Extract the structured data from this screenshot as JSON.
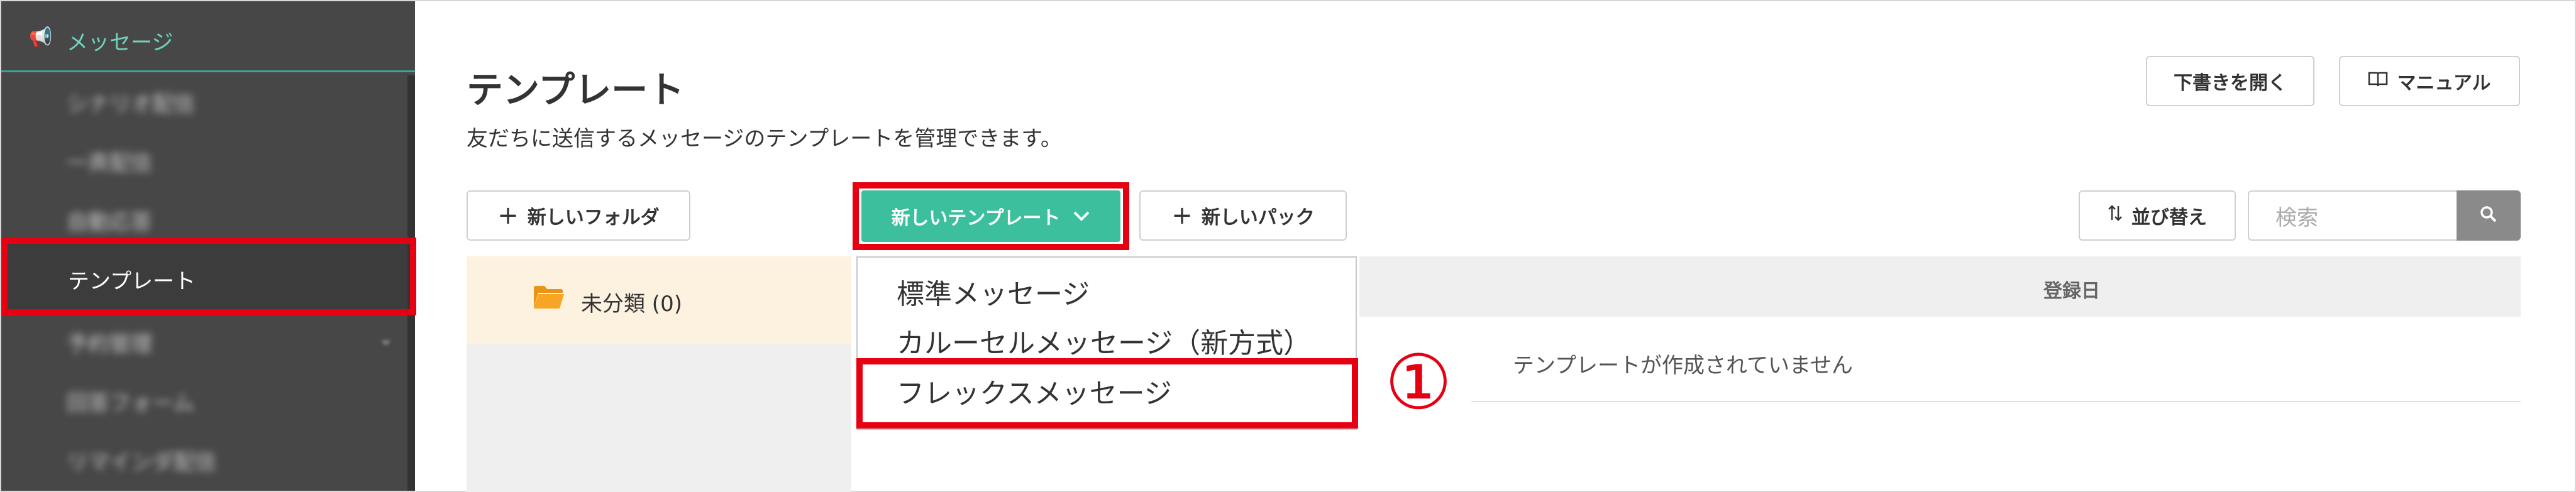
{
  "sidebar": {
    "section_label": "メッセージ",
    "section_icon": "megaphone-icon",
    "items": [
      {
        "label": "シナリオ配信"
      },
      {
        "label": "一斉配信"
      },
      {
        "label": "自動応答"
      },
      {
        "label": "テンプレート"
      },
      {
        "label": "予約管理"
      },
      {
        "label": "回答フォーム"
      },
      {
        "label": "リマインダ配信"
      }
    ],
    "active_item": "テンプレート"
  },
  "header": {
    "title": "テンプレート",
    "description": "友だちに送信するメッセージのテンプレートを管理できます。",
    "open_draft_label": "下書きを開く",
    "manual_label": "マニュアル"
  },
  "toolbar": {
    "new_folder_label": "新しいフォルダ",
    "new_template_label": "新しいテンプレート",
    "new_pack_label": "新しいパック",
    "sort_label": "並び替え",
    "search_placeholder": "検索"
  },
  "folders": [
    {
      "label": "未分類 (0)"
    }
  ],
  "dropdown": {
    "items": [
      {
        "label": "標準メッセージ"
      },
      {
        "label": "カルーセルメッセージ（新方式）"
      },
      {
        "label": "フレックスメッセージ"
      }
    ]
  },
  "table": {
    "column_registered": "登録日",
    "empty_message": "テンプレートが作成されていません"
  },
  "annotation": {
    "step_marker": "①"
  },
  "colors": {
    "accent": "#3cbf9d",
    "sidebar_bg": "#474747",
    "highlight": "#e60012",
    "folder_active_bg": "#fdf1df"
  }
}
